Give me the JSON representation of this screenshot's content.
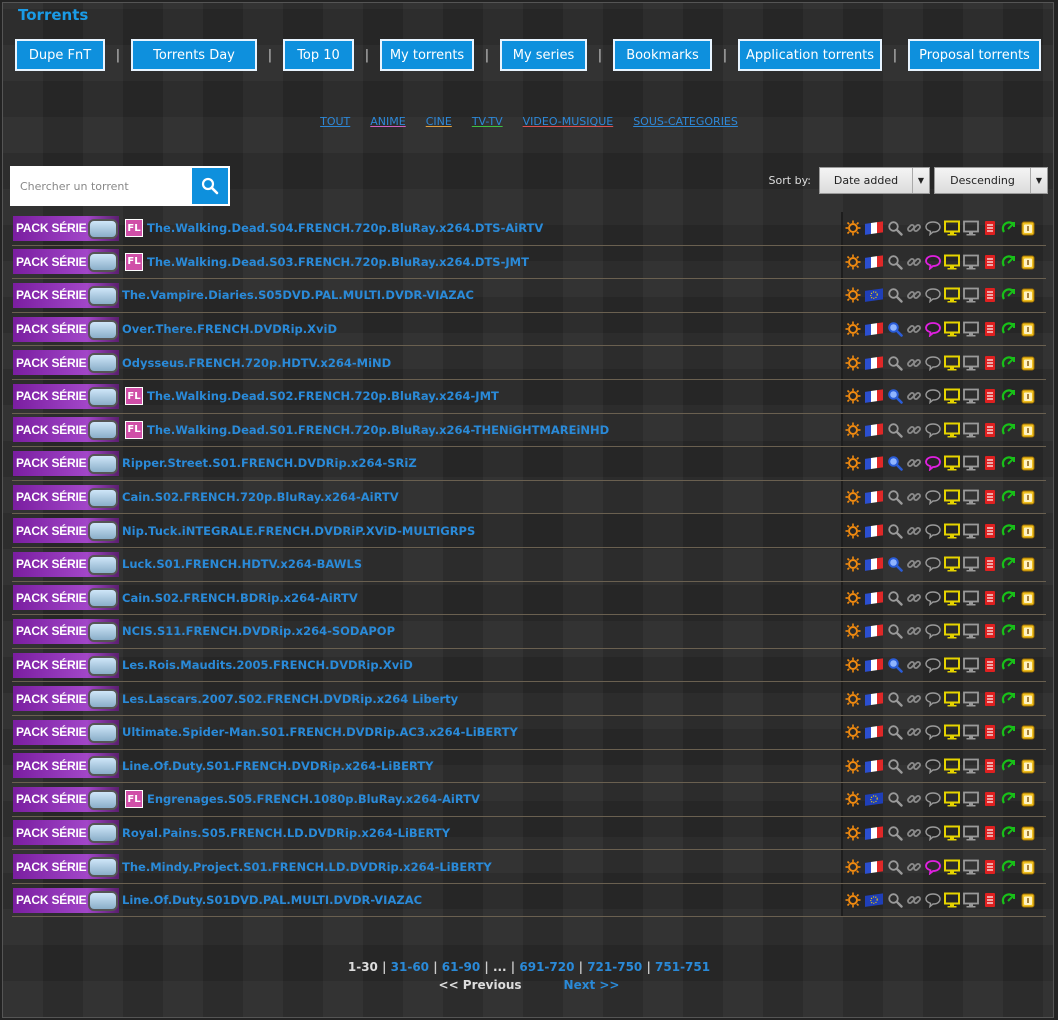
{
  "page_title": "Torrents",
  "nav": [
    {
      "label": "Dupe FnT",
      "width": 90
    },
    {
      "label": "Torrents Day",
      "width": 126
    },
    {
      "label": "Top 10",
      "width": 71
    },
    {
      "label": "My torrents",
      "width": 94
    },
    {
      "label": "My series",
      "width": 87
    },
    {
      "label": "Bookmarks",
      "width": 99
    },
    {
      "label": "Application torrents",
      "width": 144
    },
    {
      "label": "Proposal torrents",
      "width": 133
    }
  ],
  "nav_separator": "|",
  "categories": [
    "TOUT",
    "ANIME",
    "CINE",
    "TV-TV",
    "VIDEO-MUSIQUE",
    "SOUS-CATEGORIES"
  ],
  "search": {
    "placeholder": "Chercher un torrent",
    "value": ""
  },
  "sort": {
    "label": "Sort by:",
    "field": "Date added",
    "order": "Descending"
  },
  "pack_label": "PACK SÉRIE",
  "fl_badge": "FL",
  "torrents": [
    {
      "name": "The.Walking.Dead.S04.FRENCH.720p.BluRay.x264.DTS-AiRTV",
      "fl": true,
      "flag": "fr",
      "search_active": false,
      "comment_active": false
    },
    {
      "name": "The.Walking.Dead.S03.FRENCH.720p.BluRay.x264.DTS-JMT",
      "fl": true,
      "flag": "fr",
      "search_active": false,
      "comment_active": true
    },
    {
      "name": "The.Vampire.Diaries.S05DVD.PAL.MULTI.DVDR-VIAZAC",
      "fl": false,
      "flag": "eu",
      "search_active": false,
      "comment_active": false
    },
    {
      "name": "Over.There.FRENCH.DVDRip.XviD",
      "fl": false,
      "flag": "fr",
      "search_active": true,
      "comment_active": true
    },
    {
      "name": "Odysseus.FRENCH.720p.HDTV.x264-MiND",
      "fl": false,
      "flag": "fr",
      "search_active": false,
      "comment_active": false
    },
    {
      "name": "The.Walking.Dead.S02.FRENCH.720p.BluRay.x264-JMT",
      "fl": true,
      "flag": "fr",
      "search_active": true,
      "comment_active": false
    },
    {
      "name": "The.Walking.Dead.S01.FRENCH.720p.BluRay.x264-THENiGHTMAREiNHD",
      "fl": true,
      "flag": "fr",
      "search_active": false,
      "comment_active": false
    },
    {
      "name": "Ripper.Street.S01.FRENCH.DVDRip.x264-SRiZ",
      "fl": false,
      "flag": "fr",
      "search_active": true,
      "comment_active": true
    },
    {
      "name": "Cain.S02.FRENCH.720p.BluRay.x264-AiRTV",
      "fl": false,
      "flag": "fr",
      "search_active": false,
      "comment_active": false
    },
    {
      "name": "Nip.Tuck.iNTEGRALE.FRENCH.DVDRiP.XViD-MULTIGRPS",
      "fl": false,
      "flag": "fr",
      "search_active": false,
      "comment_active": false
    },
    {
      "name": "Luck.S01.FRENCH.HDTV.x264-BAWLS",
      "fl": false,
      "flag": "fr",
      "search_active": true,
      "comment_active": false
    },
    {
      "name": "Cain.S02.FRENCH.BDRip.x264-AiRTV",
      "fl": false,
      "flag": "fr",
      "search_active": false,
      "comment_active": false
    },
    {
      "name": "NCIS.S11.FRENCH.DVDRip.x264-SODAPOP",
      "fl": false,
      "flag": "fr",
      "search_active": false,
      "comment_active": false
    },
    {
      "name": "Les.Rois.Maudits.2005.FRENCH.DVDRip.XviD",
      "fl": false,
      "flag": "fr",
      "search_active": true,
      "comment_active": false
    },
    {
      "name": "Les.Lascars.2007.S02.FRENCH.DVDRip.x264 Liberty",
      "fl": false,
      "flag": "fr",
      "search_active": false,
      "comment_active": false
    },
    {
      "name": "Ultimate.Spider-Man.S01.FRENCH.DVDRip.AC3.x264-LiBERTY",
      "fl": false,
      "flag": "fr",
      "search_active": false,
      "comment_active": false
    },
    {
      "name": "Line.Of.Duty.S01.FRENCH.DVDRip.x264-LiBERTY",
      "fl": false,
      "flag": "fr",
      "search_active": false,
      "comment_active": false
    },
    {
      "name": "Engrenages.S05.FRENCH.1080p.BluRay.x264-AiRTV",
      "fl": true,
      "flag": "eu",
      "search_active": false,
      "comment_active": false
    },
    {
      "name": "Royal.Pains.S05.FRENCH.LD.DVDRip.x264-LiBERTY",
      "fl": false,
      "flag": "fr",
      "search_active": false,
      "comment_active": false
    },
    {
      "name": "The.Mindy.Project.S01.FRENCH.LD.DVDRip.x264-LiBERTY",
      "fl": false,
      "flag": "fr",
      "search_active": false,
      "comment_active": true
    },
    {
      "name": "Line.Of.Duty.S01DVD.PAL.MULTI.DVDR-VIAZAC",
      "fl": false,
      "flag": "eu",
      "search_active": false,
      "comment_active": false
    }
  ],
  "pagination": {
    "current": "1-30",
    "pages": [
      "31-60",
      "61-90",
      "...",
      "691-720",
      "721-750",
      "751-751"
    ],
    "previous": "<< Previous",
    "next": "Next >>"
  },
  "colors": {
    "accent": "#0e90dd",
    "link": "#2a8ad8",
    "pack": "#8a2bb0",
    "fl": "#d04fa8",
    "comment_active": "#e020e0",
    "search_active": "#2a5cd8"
  }
}
